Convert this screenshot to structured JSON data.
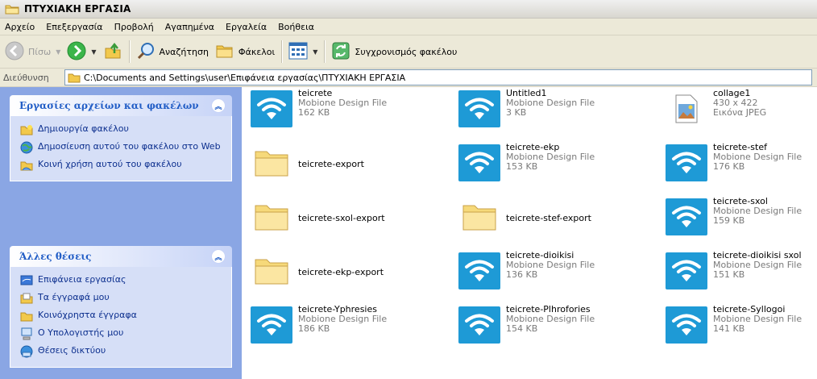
{
  "window": {
    "title": "ΠΤΥΧΙΑΚΗ ΕΡΓΑΣΙΑ"
  },
  "menu": [
    "Αρχείο",
    "Επεξεργασία",
    "Προβολή",
    "Αγαπημένα",
    "Εργαλεία",
    "Βοήθεια"
  ],
  "toolbar": {
    "back_label": "Πίσω",
    "search_label": "Αναζήτηση",
    "folders_label": "Φάκελοι",
    "sync_label": "Συγχρονισμός φακέλου"
  },
  "address": {
    "label": "Διεύθυνση",
    "path": "C:\\Documents and Settings\\user\\Επιφάνεια εργασίας\\ΠΤΥΧΙΑΚΗ ΕΡΓΑΣΙΑ"
  },
  "tasks_panel": {
    "title": "Εργασίες αρχείων και φακέλων",
    "items": [
      {
        "label": "Δημιουργία φακέλου",
        "icon": "new-folder-icon"
      },
      {
        "label": "Δημοσίευση αυτού του φακέλου στο Web",
        "icon": "publish-web-icon"
      },
      {
        "label": "Κοινή χρήση αυτού του φακέλου",
        "icon": "share-folder-icon"
      }
    ]
  },
  "places_panel": {
    "title": "Άλλες θέσεις",
    "items": [
      {
        "label": "Επιφάνεια εργασίας",
        "icon": "desktop-icon"
      },
      {
        "label": "Τα έγγραφά μου",
        "icon": "my-documents-icon"
      },
      {
        "label": "Κοινόχρηστα έγγραφα",
        "icon": "shared-documents-icon"
      },
      {
        "label": "Ο Υπολογιστής μου",
        "icon": "my-computer-icon"
      },
      {
        "label": "Θέσεις δικτύου",
        "icon": "network-places-icon"
      }
    ]
  },
  "files": [
    {
      "name": "teicrete",
      "type": "Mobione Design File",
      "size": "162 KB",
      "kind": "mobione"
    },
    {
      "name": "Untitled1",
      "type": "Mobione Design File",
      "size": "3 KB",
      "kind": "mobione"
    },
    {
      "name": "collage1",
      "type": "430 x 422",
      "size": "Εικόνα JPEG",
      "kind": "image"
    },
    {
      "name": "teicrete-export",
      "type": "",
      "size": "",
      "kind": "folder"
    },
    {
      "name": "teicrete-ekp",
      "type": "Mobione Design File",
      "size": "153 KB",
      "kind": "mobione"
    },
    {
      "name": "teicrete-stef",
      "type": "Mobione Design File",
      "size": "176 KB",
      "kind": "mobione"
    },
    {
      "name": "teicrete-sxol-export",
      "type": "",
      "size": "",
      "kind": "folder"
    },
    {
      "name": "teicrete-stef-export",
      "type": "",
      "size": "",
      "kind": "folder"
    },
    {
      "name": "teicrete-sxol",
      "type": "Mobione Design File",
      "size": "159 KB",
      "kind": "mobione"
    },
    {
      "name": "teicrete-ekp-export",
      "type": "",
      "size": "",
      "kind": "folder"
    },
    {
      "name": "teicrete-dioikisi",
      "type": "Mobione Design File",
      "size": "136 KB",
      "kind": "mobione"
    },
    {
      "name": "teicrete-dioikisi sxol",
      "type": "Mobione Design File",
      "size": "151 KB",
      "kind": "mobione"
    },
    {
      "name": "teicrete-Yphresies",
      "type": "Mobione Design File",
      "size": "186 KB",
      "kind": "mobione"
    },
    {
      "name": "teicrete-Plhrofories",
      "type": "Mobione Design File",
      "size": "154 KB",
      "kind": "mobione"
    },
    {
      "name": "teicrete-Syllogoi",
      "type": "Mobione Design File",
      "size": "141 KB",
      "kind": "mobione"
    }
  ]
}
